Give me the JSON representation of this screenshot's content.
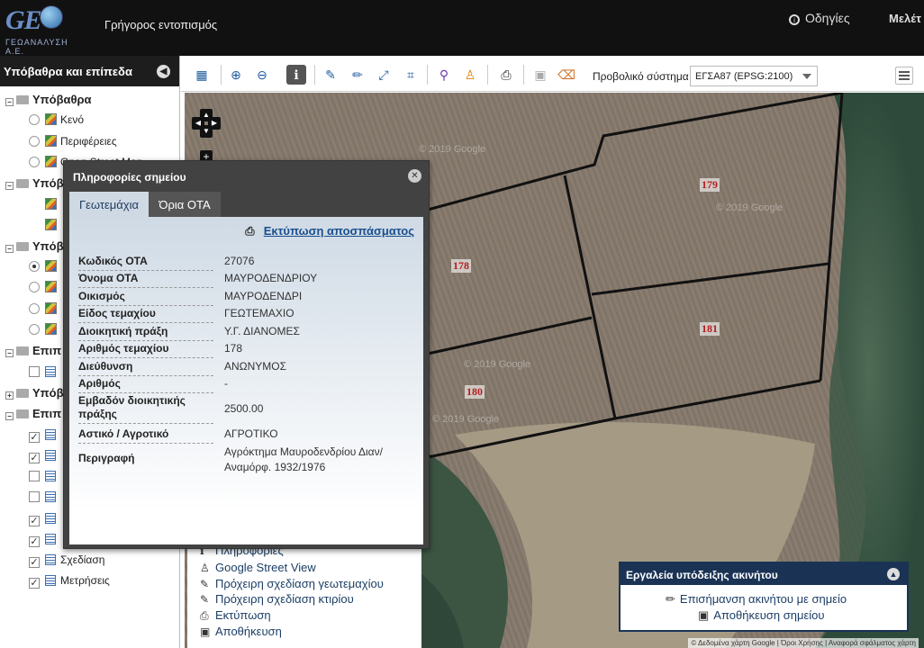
{
  "header": {
    "logo_word": "GE",
    "logo_sub": "ΓΕΩΑΝΑΛΥΣΗ Α.Ε.",
    "quick_search": "Γρήγορος εντοπισμός",
    "help": "Οδηγίες",
    "study": "Μελέτ"
  },
  "sidebar": {
    "title": "Υπόβαθρα και επίπεδα",
    "groups": {
      "g1": "Υπόβαθρα",
      "g1_items": [
        "Κενό",
        "Περιφέρειες",
        "Open Street Map"
      ],
      "g2": "Υπόβ",
      "g3": "Υπόβ",
      "g4": "Επιπ",
      "g5": "Υπόβ",
      "g6": "Επιπ",
      "g6_items": [
        "Σχεδίαση",
        "Μετρήσεις"
      ]
    }
  },
  "toolbar": {
    "projection_label": "Προβολικό σύστημα",
    "projection_value": "ΕΓΣΑ87 (EPSG:2100)"
  },
  "map": {
    "parcels": [
      "179",
      "178",
      "181",
      "180"
    ],
    "watermark": "© 2019 Google",
    "attribution": "© Δεδομένα χάρτη Google | Όροι Χρήσης | Αναφορά σφάλματος χάρτη"
  },
  "context_menu": [
    "Πληροφορίες",
    "Google Street View",
    "Πρόχειρη σχεδίαση γεωτεμαχίου",
    "Πρόχειρη σχεδίαση κτιρίου",
    "Εκτύπωση",
    "Αποθήκευση"
  ],
  "tools_panel": {
    "title": "Εργαλεία υπόδειξης ακινήτου",
    "mark": "Επισήμανση ακινήτου με σημείο",
    "save": "Αποθήκευση σημείου"
  },
  "popup": {
    "title": "Πληροφορίες σημείου",
    "tabs": [
      "Γεωτεμάχια",
      "Όρια ΟΤΑ"
    ],
    "print": "Εκτύπωση αποσπάσματος",
    "rows": [
      {
        "label": "Κωδικός ΟΤΑ",
        "value": "27076"
      },
      {
        "label": "Όνομα ΟΤΑ",
        "value": "ΜΑΥΡΟΔΕΝΔΡΙΟΥ"
      },
      {
        "label": "Οικισμός",
        "value": "ΜΑΥΡΟΔΕΝΔΡΙ"
      },
      {
        "label": "Είδος τεμαχίου",
        "value": "ΓΕΩΤΕΜΑΧΙΟ"
      },
      {
        "label": "Διοικητική πράξη",
        "value": "Υ.Γ. ΔΙΑΝΟΜΕΣ"
      },
      {
        "label": "Αριθμός τεμαχίου",
        "value": "178"
      },
      {
        "label": "Διεύθυνση",
        "value": "ΑΝΩΝΥΜΟΣ"
      },
      {
        "label": "Αριθμός",
        "value": "-"
      },
      {
        "label": "Εμβαδόν διοικητικής πράξης",
        "value": "2500.00"
      },
      {
        "label": "Αστικό / Αγροτικό",
        "value": "ΑΓΡΟΤΙΚΟ"
      },
      {
        "label": "Περιγραφή",
        "value": "Αγρόκτημα Μαυροδενδρίου Διαν/ Αναμόρφ. 1932/1976"
      }
    ]
  }
}
